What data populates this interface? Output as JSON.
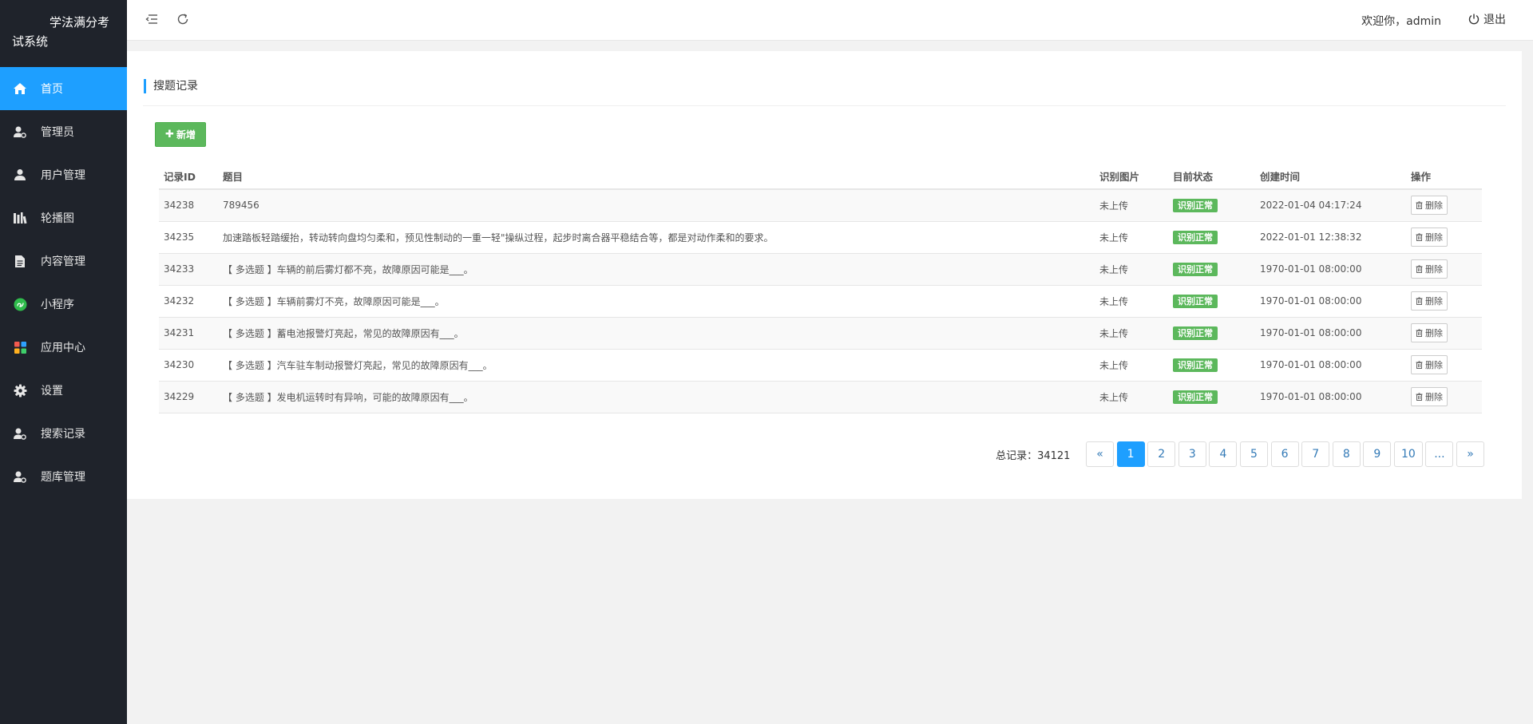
{
  "app": {
    "brand_line1": "学法满分考",
    "brand_line2": "试系统"
  },
  "sidebar": {
    "items": [
      {
        "label": "首页",
        "icon": "home-icon",
        "active": true
      },
      {
        "label": "管理员",
        "icon": "admin-icon"
      },
      {
        "label": "用户管理",
        "icon": "user-icon"
      },
      {
        "label": "轮播图",
        "icon": "carousel-icon"
      },
      {
        "label": "内容管理",
        "icon": "document-icon"
      },
      {
        "label": "小程序",
        "icon": "mini-program-icon"
      },
      {
        "label": "应用中心",
        "icon": "app-center-icon"
      },
      {
        "label": "设置",
        "icon": "gear-icon"
      },
      {
        "label": "搜索记录",
        "icon": "search-record-icon"
      },
      {
        "label": "题库管理",
        "icon": "question-bank-icon"
      }
    ]
  },
  "header": {
    "welcome": "欢迎你，admin",
    "logout_label": "退出"
  },
  "card": {
    "title": "搜题记录",
    "add_label": "新增"
  },
  "table": {
    "columns": [
      "记录ID",
      "题目",
      "识别图片",
      "目前状态",
      "创建时间",
      "操作"
    ],
    "rows": [
      {
        "id": "34238",
        "question": "789456",
        "image": "未上传",
        "status": "识别正常",
        "created": "2022-01-04 04:17:24",
        "action": "删除"
      },
      {
        "id": "34235",
        "question": "加速踏板轻踏缓抬，转动转向盘均匀柔和，预见性制动的一重一轻\"操纵过程，起步时离合器平稳结合等，都是对动作柔和的要求。",
        "image": "未上传",
        "status": "识别正常",
        "created": "2022-01-01 12:38:32",
        "action": "删除"
      },
      {
        "id": "34233",
        "question": "【 多选题 】车辆的前后雾灯都不亮，故障原因可能是___。",
        "image": "未上传",
        "status": "识别正常",
        "created": "1970-01-01 08:00:00",
        "action": "删除"
      },
      {
        "id": "34232",
        "question": "【 多选题 】车辆前雾灯不亮，故障原因可能是___。",
        "image": "未上传",
        "status": "识别正常",
        "created": "1970-01-01 08:00:00",
        "action": "删除"
      },
      {
        "id": "34231",
        "question": "【 多选题 】蓄电池报警灯亮起，常见的故障原因有___。",
        "image": "未上传",
        "status": "识别正常",
        "created": "1970-01-01 08:00:00",
        "action": "删除"
      },
      {
        "id": "34230",
        "question": "【 多选题 】汽车驻车制动报警灯亮起，常见的故障原因有___。",
        "image": "未上传",
        "status": "识别正常",
        "created": "1970-01-01 08:00:00",
        "action": "删除"
      },
      {
        "id": "34229",
        "question": "【 多选题 】发电机运转时有异响，可能的故障原因有___。",
        "image": "未上传",
        "status": "识别正常",
        "created": "1970-01-01 08:00:00",
        "action": "删除"
      }
    ]
  },
  "pagination": {
    "total_text": "总记录：34121",
    "prev": "«",
    "next": "»",
    "pages": [
      "1",
      "2",
      "3",
      "4",
      "5",
      "6",
      "7",
      "8",
      "9",
      "10",
      "..."
    ],
    "current": "1"
  },
  "colors": {
    "sidebar_bg": "#1f232b",
    "accent": "#1e9fff",
    "success": "#5cb85c"
  }
}
